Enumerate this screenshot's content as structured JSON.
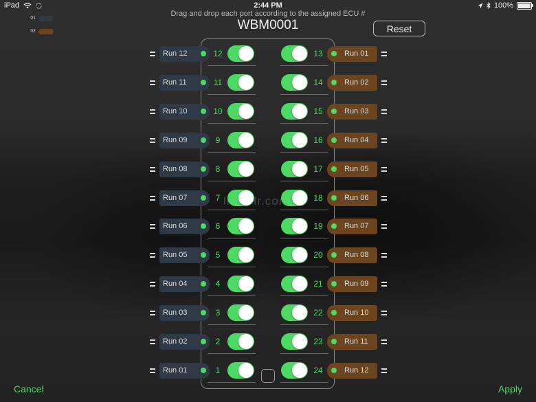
{
  "status_bar": {
    "device": "iPad",
    "time": "2:44 PM",
    "battery_text": "100%",
    "battery_level": 1.0,
    "icons": [
      "wifi-icon",
      "sync-icon",
      "location-arrow-icon",
      "bluetooth-icon",
      "battery-icon"
    ]
  },
  "legend": [
    {
      "label": "01",
      "color": "#2f3a46"
    },
    {
      "label": "02",
      "color": "#6a4520"
    }
  ],
  "instructions": "Drag and drop each port according to the assigned ECU #",
  "title": "WBM0001",
  "reset_label": "Reset",
  "watermark": "lndaHr.com",
  "left_ports": [
    {
      "run": "Run 12",
      "port": "12",
      "on": true
    },
    {
      "run": "Run 11",
      "port": "11",
      "on": true
    },
    {
      "run": "Run 10",
      "port": "10",
      "on": true
    },
    {
      "run": "Run 09",
      "port": "9",
      "on": true
    },
    {
      "run": "Run 08",
      "port": "8",
      "on": true
    },
    {
      "run": "Run 07",
      "port": "7",
      "on": true
    },
    {
      "run": "Run 06",
      "port": "6",
      "on": true
    },
    {
      "run": "Run 05",
      "port": "5",
      "on": true
    },
    {
      "run": "Run 04",
      "port": "4",
      "on": true
    },
    {
      "run": "Run 03",
      "port": "3",
      "on": true
    },
    {
      "run": "Run 02",
      "port": "2",
      "on": true
    },
    {
      "run": "Run 01",
      "port": "1",
      "on": true
    }
  ],
  "right_ports": [
    {
      "run": "Run 01",
      "port": "13",
      "on": true
    },
    {
      "run": "Run 02",
      "port": "14",
      "on": true
    },
    {
      "run": "Run 03",
      "port": "15",
      "on": true
    },
    {
      "run": "Run 04",
      "port": "16",
      "on": true
    },
    {
      "run": "Run 05",
      "port": "17",
      "on": true
    },
    {
      "run": "Run 06",
      "port": "18",
      "on": true
    },
    {
      "run": "Run 07",
      "port": "19",
      "on": true
    },
    {
      "run": "Run 08",
      "port": "20",
      "on": true
    },
    {
      "run": "Run 09",
      "port": "21",
      "on": true
    },
    {
      "run": "Run 10",
      "port": "22",
      "on": true
    },
    {
      "run": "Run 11",
      "port": "23",
      "on": true
    },
    {
      "run": "Run 12",
      "port": "24",
      "on": true
    }
  ],
  "colors": {
    "accent_green": "#4cd964",
    "left_tag": "#2f3a46",
    "right_tag": "#6a4520"
  },
  "footer": {
    "cancel_label": "Cancel",
    "apply_label": "Apply"
  }
}
